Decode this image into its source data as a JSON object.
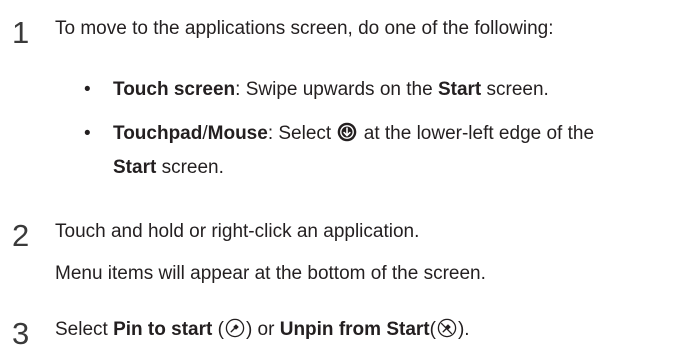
{
  "steps": [
    {
      "number": "1",
      "text": "To move to the applications screen, do one of the following:",
      "bullets": [
        {
          "marker": "•",
          "bold1": "Touch screen",
          "text1": ": Swipe upwards on the ",
          "bold2": "Start",
          "text2": " screen."
        },
        {
          "marker": "•",
          "bold1": "Touchpad",
          "slash": "/",
          "bold1b": "Mouse",
          "text1": ": Select ",
          "icon": "down-arrow-circle-icon",
          "text2": " at the lower-left edge of the",
          "bold2": "Start",
          "text3": " screen."
        }
      ]
    },
    {
      "number": "2",
      "text": "Touch and hold or right-click an application.",
      "subtext": "Menu items will appear at the bottom of the screen."
    },
    {
      "number": "3",
      "text_prefix": "Select ",
      "bold1": "Pin to start",
      "paren_open1": " (",
      "icon1": "pin-icon",
      "paren_close1": ") or ",
      "bold2": "Unpin from Start",
      "paren_open2": "(",
      "icon2": "unpin-icon",
      "paren_close2": ")."
    }
  ]
}
